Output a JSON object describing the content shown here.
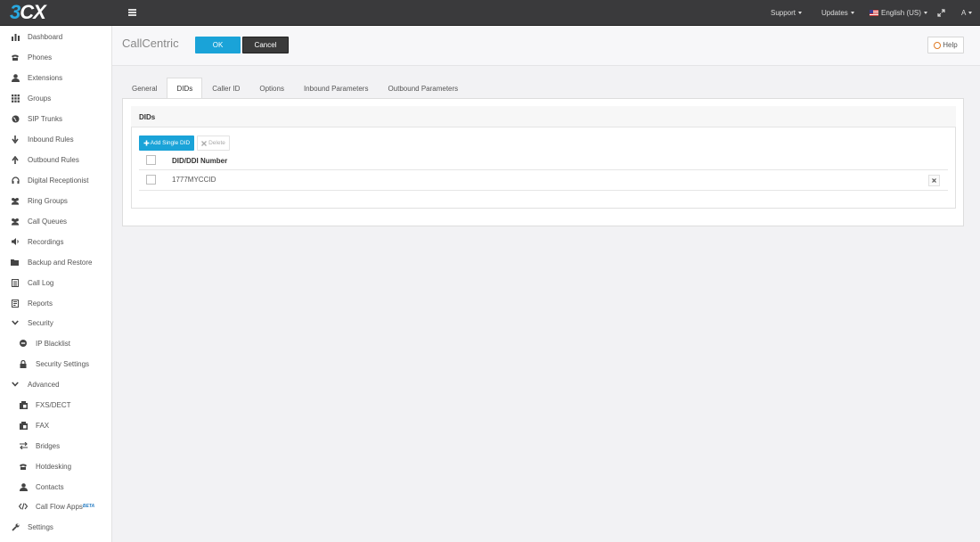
{
  "app": {
    "logo_prefix": "3",
    "logo_suffix": "CX"
  },
  "topnav": {
    "support": "Support",
    "updates": "Updates",
    "language": "English (US)",
    "user": "A"
  },
  "sidebar": {
    "items": [
      {
        "label": "Dashboard",
        "icon": "bar-chart-icon"
      },
      {
        "label": "Phones",
        "icon": "phone-icon"
      },
      {
        "label": "Extensions",
        "icon": "user-icon"
      },
      {
        "label": "Groups",
        "icon": "grid-icon"
      },
      {
        "label": "SIP Trunks",
        "icon": "globe-icon"
      },
      {
        "label": "Inbound Rules",
        "icon": "arrow-down-icon"
      },
      {
        "label": "Outbound Rules",
        "icon": "arrow-up-icon"
      },
      {
        "label": "Digital Receptionist",
        "icon": "headset-icon"
      },
      {
        "label": "Ring Groups",
        "icon": "users-icon"
      },
      {
        "label": "Call Queues",
        "icon": "users-icon"
      },
      {
        "label": "Recordings",
        "icon": "speaker-icon"
      },
      {
        "label": "Backup and Restore",
        "icon": "folder-icon"
      },
      {
        "label": "Call Log",
        "icon": "list-icon"
      },
      {
        "label": "Reports",
        "icon": "report-icon"
      },
      {
        "label": "Security",
        "icon": "chevron-down-icon"
      },
      {
        "label": "IP Blacklist",
        "icon": "minus-circle-icon"
      },
      {
        "label": "Security Settings",
        "icon": "lock-icon"
      },
      {
        "label": "Advanced",
        "icon": "chevron-down-icon"
      },
      {
        "label": "FXS/DECT",
        "icon": "fax-icon"
      },
      {
        "label": "FAX",
        "icon": "fax-icon"
      },
      {
        "label": "Bridges",
        "icon": "exchange-icon"
      },
      {
        "label": "Hotdesking",
        "icon": "phone-icon"
      },
      {
        "label": "Contacts",
        "icon": "user-icon"
      },
      {
        "label": "Call Flow Apps",
        "icon": "code-icon",
        "badge": "BETA"
      },
      {
        "label": "Settings",
        "icon": "wrench-icon"
      }
    ]
  },
  "page": {
    "title": "CallCentric",
    "ok_label": "OK",
    "cancel_label": "Cancel",
    "help_label": "Help"
  },
  "tabs": [
    {
      "label": "General"
    },
    {
      "label": "DIDs"
    },
    {
      "label": "Caller ID"
    },
    {
      "label": "Options"
    },
    {
      "label": "Inbound Parameters"
    },
    {
      "label": "Outbound Parameters"
    }
  ],
  "dids": {
    "section_title": "DIDs",
    "add_label": "Add Single DID",
    "delete_label": "Delete",
    "column_header": "DID/DDI Number",
    "rows": [
      {
        "number": "1777MYCCID"
      }
    ]
  }
}
